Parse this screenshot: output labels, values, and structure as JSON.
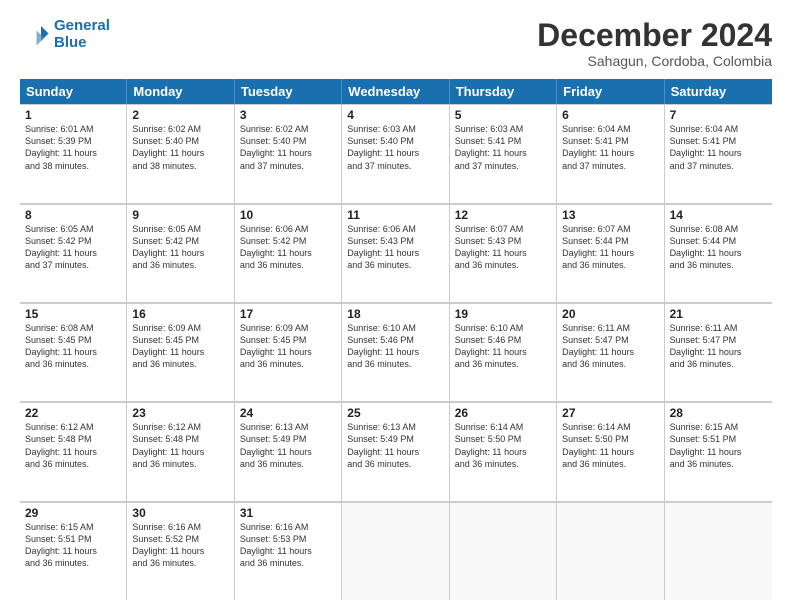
{
  "logo": {
    "line1": "General",
    "line2": "Blue"
  },
  "title": "December 2024",
  "subtitle": "Sahagun, Cordoba, Colombia",
  "header_days": [
    "Sunday",
    "Monday",
    "Tuesday",
    "Wednesday",
    "Thursday",
    "Friday",
    "Saturday"
  ],
  "weeks": [
    [
      {
        "day": "1",
        "text": "Sunrise: 6:01 AM\nSunset: 5:39 PM\nDaylight: 11 hours\nand 38 minutes."
      },
      {
        "day": "2",
        "text": "Sunrise: 6:02 AM\nSunset: 5:40 PM\nDaylight: 11 hours\nand 38 minutes."
      },
      {
        "day": "3",
        "text": "Sunrise: 6:02 AM\nSunset: 5:40 PM\nDaylight: 11 hours\nand 37 minutes."
      },
      {
        "day": "4",
        "text": "Sunrise: 6:03 AM\nSunset: 5:40 PM\nDaylight: 11 hours\nand 37 minutes."
      },
      {
        "day": "5",
        "text": "Sunrise: 6:03 AM\nSunset: 5:41 PM\nDaylight: 11 hours\nand 37 minutes."
      },
      {
        "day": "6",
        "text": "Sunrise: 6:04 AM\nSunset: 5:41 PM\nDaylight: 11 hours\nand 37 minutes."
      },
      {
        "day": "7",
        "text": "Sunrise: 6:04 AM\nSunset: 5:41 PM\nDaylight: 11 hours\nand 37 minutes."
      }
    ],
    [
      {
        "day": "8",
        "text": "Sunrise: 6:05 AM\nSunset: 5:42 PM\nDaylight: 11 hours\nand 37 minutes."
      },
      {
        "day": "9",
        "text": "Sunrise: 6:05 AM\nSunset: 5:42 PM\nDaylight: 11 hours\nand 36 minutes."
      },
      {
        "day": "10",
        "text": "Sunrise: 6:06 AM\nSunset: 5:42 PM\nDaylight: 11 hours\nand 36 minutes."
      },
      {
        "day": "11",
        "text": "Sunrise: 6:06 AM\nSunset: 5:43 PM\nDaylight: 11 hours\nand 36 minutes."
      },
      {
        "day": "12",
        "text": "Sunrise: 6:07 AM\nSunset: 5:43 PM\nDaylight: 11 hours\nand 36 minutes."
      },
      {
        "day": "13",
        "text": "Sunrise: 6:07 AM\nSunset: 5:44 PM\nDaylight: 11 hours\nand 36 minutes."
      },
      {
        "day": "14",
        "text": "Sunrise: 6:08 AM\nSunset: 5:44 PM\nDaylight: 11 hours\nand 36 minutes."
      }
    ],
    [
      {
        "day": "15",
        "text": "Sunrise: 6:08 AM\nSunset: 5:45 PM\nDaylight: 11 hours\nand 36 minutes."
      },
      {
        "day": "16",
        "text": "Sunrise: 6:09 AM\nSunset: 5:45 PM\nDaylight: 11 hours\nand 36 minutes."
      },
      {
        "day": "17",
        "text": "Sunrise: 6:09 AM\nSunset: 5:45 PM\nDaylight: 11 hours\nand 36 minutes."
      },
      {
        "day": "18",
        "text": "Sunrise: 6:10 AM\nSunset: 5:46 PM\nDaylight: 11 hours\nand 36 minutes."
      },
      {
        "day": "19",
        "text": "Sunrise: 6:10 AM\nSunset: 5:46 PM\nDaylight: 11 hours\nand 36 minutes."
      },
      {
        "day": "20",
        "text": "Sunrise: 6:11 AM\nSunset: 5:47 PM\nDaylight: 11 hours\nand 36 minutes."
      },
      {
        "day": "21",
        "text": "Sunrise: 6:11 AM\nSunset: 5:47 PM\nDaylight: 11 hours\nand 36 minutes."
      }
    ],
    [
      {
        "day": "22",
        "text": "Sunrise: 6:12 AM\nSunset: 5:48 PM\nDaylight: 11 hours\nand 36 minutes."
      },
      {
        "day": "23",
        "text": "Sunrise: 6:12 AM\nSunset: 5:48 PM\nDaylight: 11 hours\nand 36 minutes."
      },
      {
        "day": "24",
        "text": "Sunrise: 6:13 AM\nSunset: 5:49 PM\nDaylight: 11 hours\nand 36 minutes."
      },
      {
        "day": "25",
        "text": "Sunrise: 6:13 AM\nSunset: 5:49 PM\nDaylight: 11 hours\nand 36 minutes."
      },
      {
        "day": "26",
        "text": "Sunrise: 6:14 AM\nSunset: 5:50 PM\nDaylight: 11 hours\nand 36 minutes."
      },
      {
        "day": "27",
        "text": "Sunrise: 6:14 AM\nSunset: 5:50 PM\nDaylight: 11 hours\nand 36 minutes."
      },
      {
        "day": "28",
        "text": "Sunrise: 6:15 AM\nSunset: 5:51 PM\nDaylight: 11 hours\nand 36 minutes."
      }
    ],
    [
      {
        "day": "29",
        "text": "Sunrise: 6:15 AM\nSunset: 5:51 PM\nDaylight: 11 hours\nand 36 minutes."
      },
      {
        "day": "30",
        "text": "Sunrise: 6:16 AM\nSunset: 5:52 PM\nDaylight: 11 hours\nand 36 minutes."
      },
      {
        "day": "31",
        "text": "Sunrise: 6:16 AM\nSunset: 5:53 PM\nDaylight: 11 hours\nand 36 minutes."
      },
      {
        "day": "",
        "text": ""
      },
      {
        "day": "",
        "text": ""
      },
      {
        "day": "",
        "text": ""
      },
      {
        "day": "",
        "text": ""
      }
    ]
  ]
}
